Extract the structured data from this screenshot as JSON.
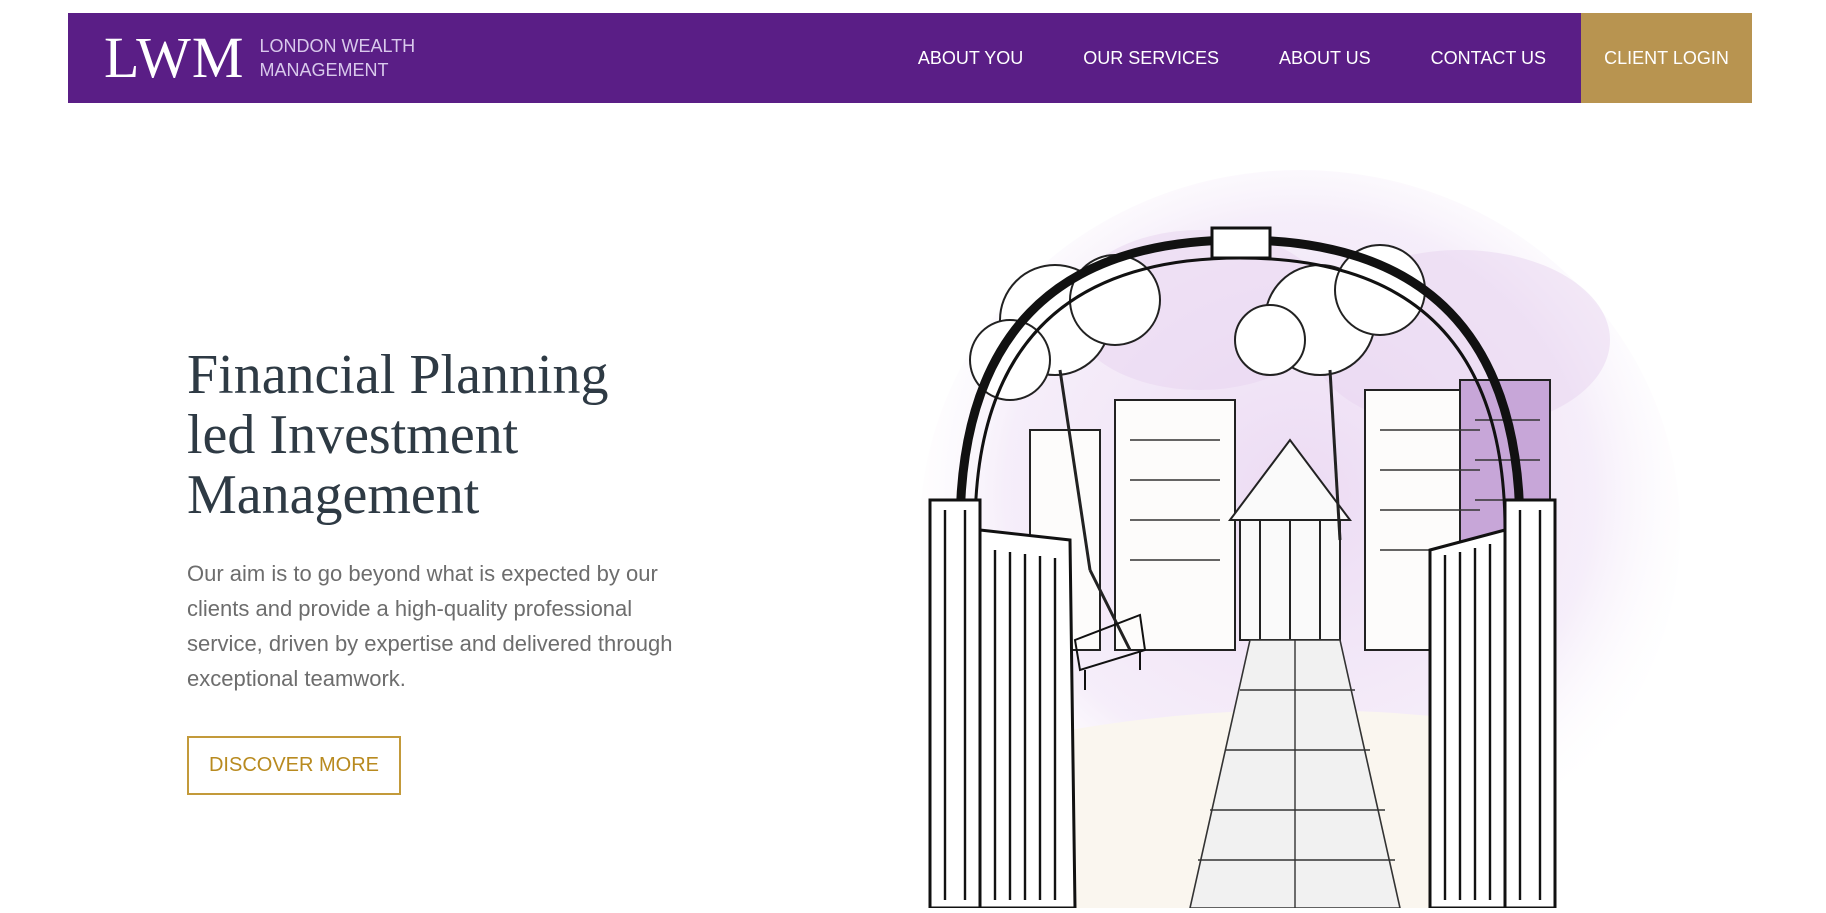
{
  "nav": {
    "logo_mark": "LWM",
    "logo_line1": "LONDON WEALTH",
    "logo_line2": "MANAGEMENT",
    "items": [
      {
        "label": "ABOUT YOU"
      },
      {
        "label": "OUR SERVICES"
      },
      {
        "label": "ABOUT US"
      },
      {
        "label": "CONTACT US"
      }
    ],
    "client_login": "CLIENT LOGIN"
  },
  "hero": {
    "title_line1": "Financial Planning",
    "title_line2": "led Investment",
    "title_line3": "Management",
    "text": "Our aim is to go beyond what is expected by our clients and provide a high-quality professional service, driven by expertise and delivered through exceptional teamwork.",
    "cta": "DISCOVER MORE"
  },
  "colors": {
    "brand_purple": "#5a1e86",
    "gold": "#b89450",
    "cta_gold": "#c39a3a",
    "heading": "#2e3a44"
  },
  "illustration": {
    "description_icon": "garden-gate-sketch-illustration"
  }
}
